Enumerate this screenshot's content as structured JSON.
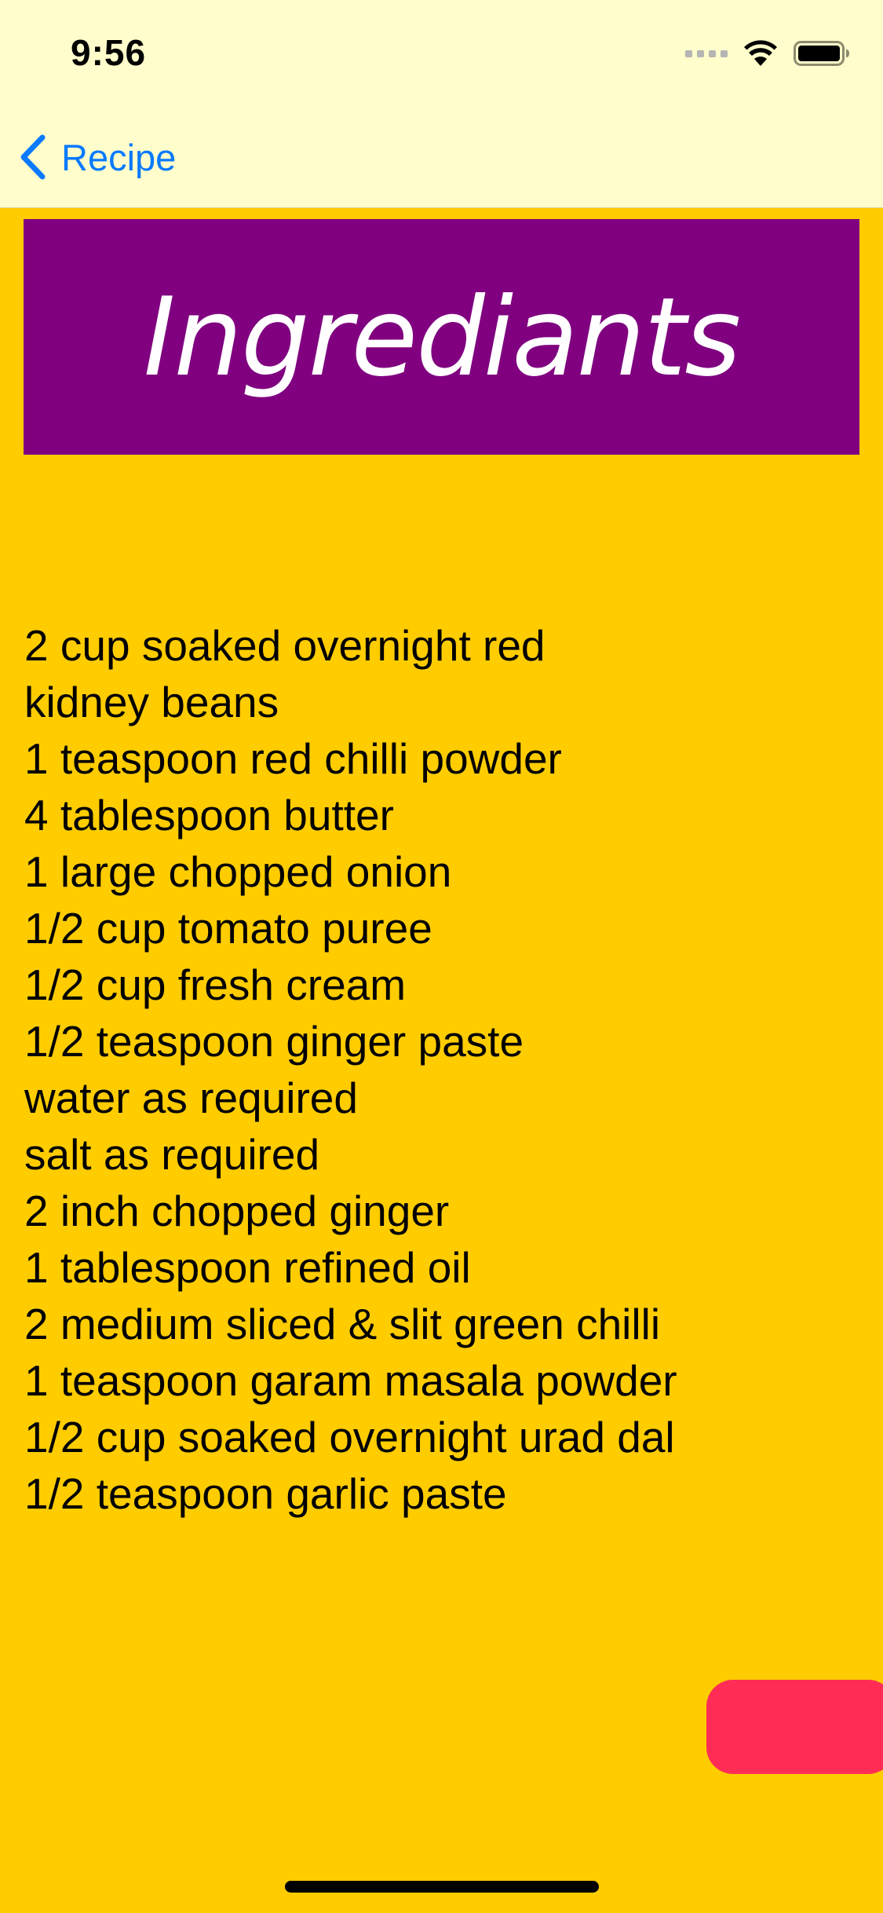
{
  "status_bar": {
    "time": "9:56",
    "icons": [
      "cellular-signal-icon",
      "wifi-icon",
      "battery-icon"
    ]
  },
  "nav_bar": {
    "back_label": "Recipe",
    "back_icon": "chevron-left-icon"
  },
  "header": {
    "title": "Ingrediants"
  },
  "ingredients": {
    "lines": [
      "2 cup soaked overnight red",
      "kidney beans",
      "1 teaspoon red chilli powder",
      "4 tablespoon butter",
      "1 large chopped onion",
      "1/2 cup tomato puree",
      "1/2 cup fresh cream",
      "1/2 teaspoon ginger paste",
      "water as required",
      "salt as required",
      "2 inch chopped ginger",
      "1 tablespoon refined oil",
      "2 medium sliced & slit green chilli",
      "1 teaspoon garam masala powder",
      "1/2 cup soaked overnight urad dal",
      "1/2 teaspoon garlic paste"
    ]
  },
  "colors": {
    "page_background": "#FFCC00",
    "top_bar_background": "#FFFDCB",
    "title_banner": "#800080",
    "accent_blue": "#0A7AFF",
    "action_button": "#FF2D55"
  }
}
